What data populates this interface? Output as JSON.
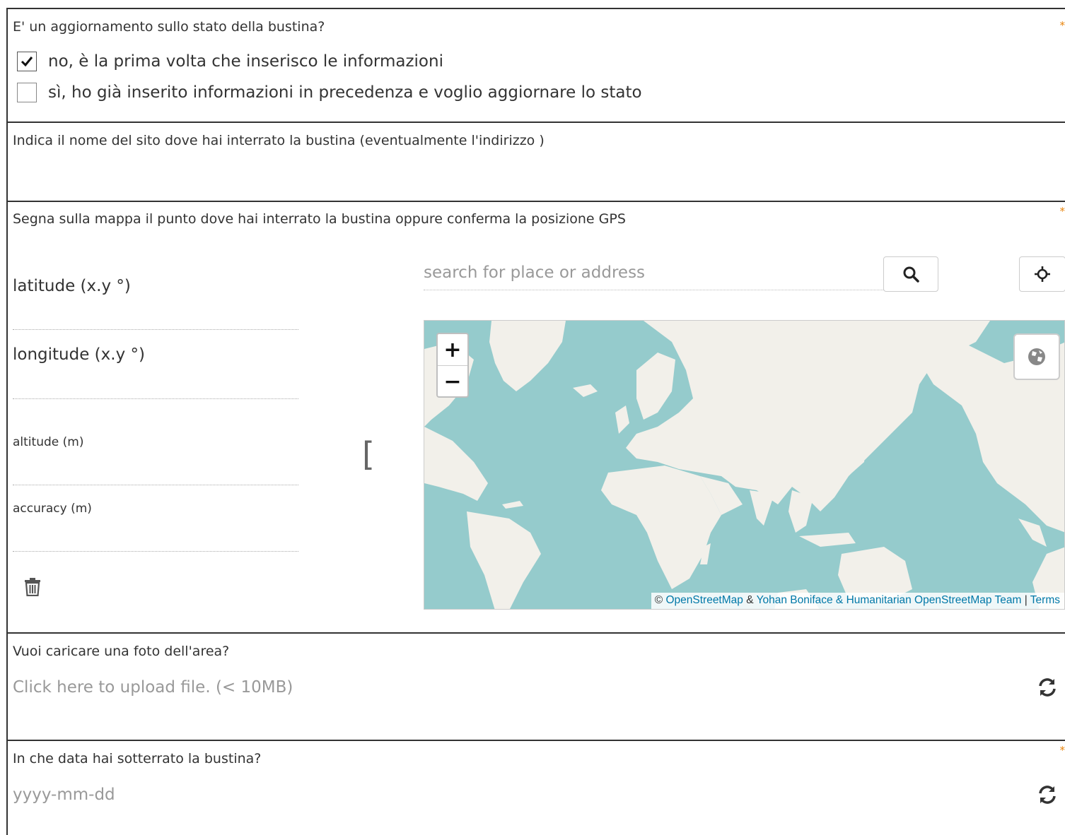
{
  "q_update": {
    "label": "E' un aggiornamento sullo stato della bustina?",
    "required": "*",
    "options": [
      {
        "label": "no, è la prima volta che inserisco le informazioni",
        "checked": true
      },
      {
        "label": "sì, ho già inserito informazioni in precedenza e voglio aggiornare lo stato",
        "checked": false
      }
    ]
  },
  "q_site": {
    "label": "Indica il nome del sito dove hai interrato la bustina (eventualmente l'indirizzo )"
  },
  "q_gps": {
    "label": "Segna sulla mappa il punto dove hai interrato la bustina oppure conferma la posizione GPS",
    "required": "*",
    "latitude_label": "latitude (x.y °)",
    "longitude_label": "longitude (x.y °)",
    "altitude_label": "altitude (m)",
    "accuracy_label": "accuracy (m)",
    "bracket": "[",
    "search_placeholder": "search for place or address",
    "zoom_in": "+",
    "zoom_out": "−",
    "attribution": {
      "copyright": "©",
      "osm": "OpenStreetMap",
      "amp": "&",
      "credit": "Yohan Boniface & Humanitarian OpenStreetMap Team",
      "sep": "|",
      "terms": "Terms"
    },
    "map_colors": {
      "water": "#95cbcc",
      "land": "#f2f0ea"
    }
  },
  "q_photo": {
    "label": "Vuoi caricare una foto dell'area?",
    "upload_placeholder": "Click here to upload file. (< 10MB)"
  },
  "q_date": {
    "label": "In che data hai sotterrato la bustina?",
    "required": "*",
    "date_placeholder": "yyyy-mm-dd"
  },
  "icons": [
    "check-icon",
    "search-icon",
    "crosshair-icon",
    "globe-icon",
    "trash-icon",
    "refresh-icon"
  ]
}
